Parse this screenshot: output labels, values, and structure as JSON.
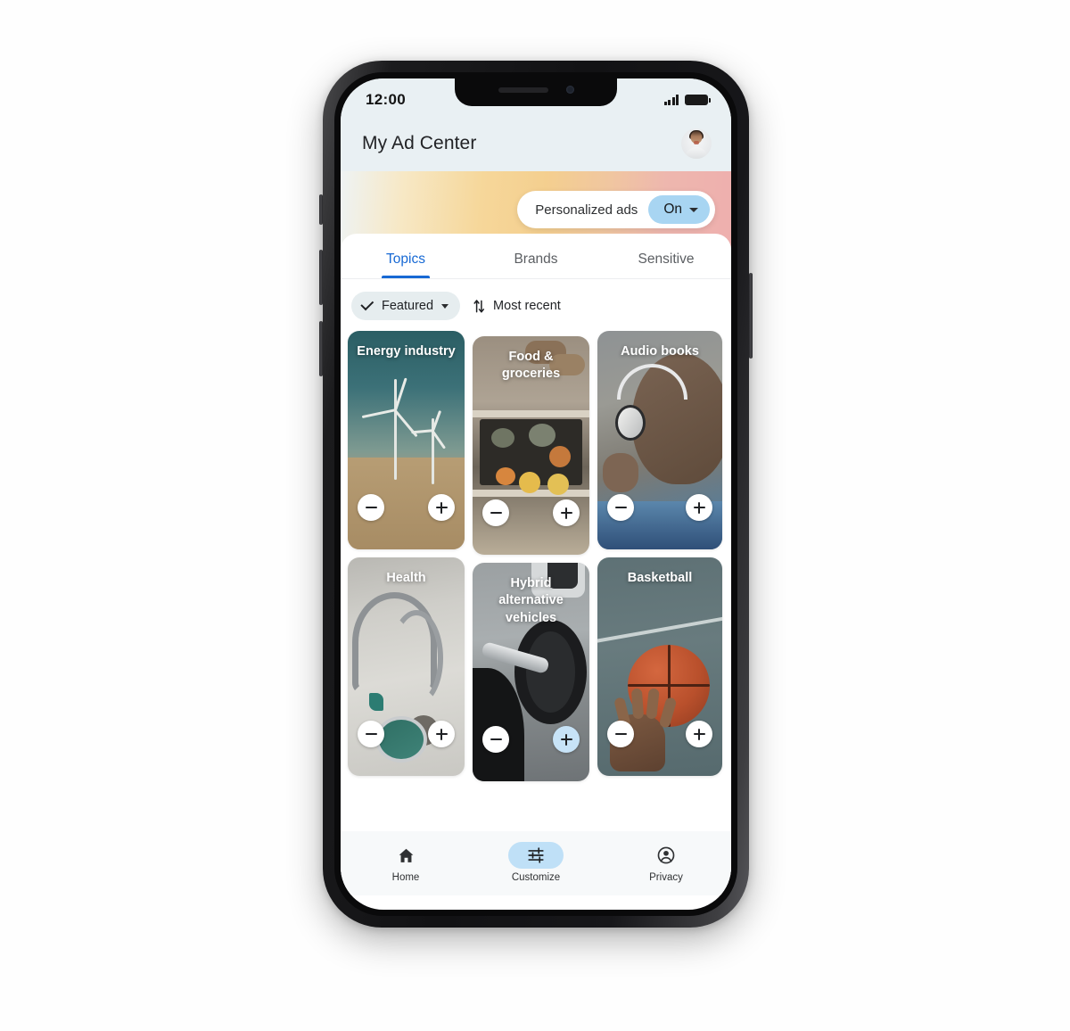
{
  "status_bar": {
    "time": "12:00",
    "signal_icon": "signal-bars-icon",
    "battery_icon": "battery-full-icon"
  },
  "app_bar": {
    "title": "My Ad Center",
    "avatar_icon": "user-avatar-photo"
  },
  "banner": {
    "label": "Personalized ads",
    "toggle_value": "On",
    "caret_icon": "chevron-down-icon",
    "gradient": [
      "#eef3f4",
      "#f6d79a",
      "#eeafae"
    ]
  },
  "tabs": {
    "active_index": 0,
    "items": [
      {
        "label": "Topics"
      },
      {
        "label": "Brands"
      },
      {
        "label": "Sensitive"
      }
    ],
    "active_color": "#1769d4"
  },
  "filters": {
    "chip_label": "Featured",
    "chip_check_icon": "check-icon",
    "chip_caret_icon": "chevron-down-icon",
    "sort_icon": "sort-arrows-icon",
    "sort_label": "Most recent"
  },
  "grid": {
    "columns": [
      {
        "cards": [
          {
            "title": "Energy industry",
            "art": "energy",
            "minus_icon": "minus-icon",
            "plus_icon": "plus-icon",
            "plus_selected": false
          },
          {
            "title": "Health",
            "art": "health",
            "minus_icon": "minus-icon",
            "plus_icon": "plus-icon",
            "plus_selected": false
          }
        ]
      },
      {
        "cards": [
          {
            "title": "Food & groceries",
            "art": "food",
            "minus_icon": "minus-icon",
            "plus_icon": "plus-icon",
            "plus_selected": false
          },
          {
            "title": "Hybrid alternative vehicles",
            "art": "hybrid",
            "minus_icon": "minus-icon",
            "plus_icon": "plus-icon",
            "plus_selected": true
          }
        ]
      },
      {
        "cards": [
          {
            "title": "Audio books",
            "art": "audio",
            "minus_icon": "minus-icon",
            "plus_icon": "plus-icon",
            "plus_selected": false
          },
          {
            "title": "Basketball",
            "art": "bball",
            "minus_icon": "minus-icon",
            "plus_icon": "plus-icon",
            "plus_selected": false
          }
        ]
      }
    ]
  },
  "bottom_nav": {
    "active_index": 1,
    "active_pill_color": "#bfe0f7",
    "items": [
      {
        "label": "Home",
        "icon": "home-icon"
      },
      {
        "label": "Customize",
        "icon": "sliders-icon"
      },
      {
        "label": "Privacy",
        "icon": "account-circle-icon"
      }
    ]
  }
}
